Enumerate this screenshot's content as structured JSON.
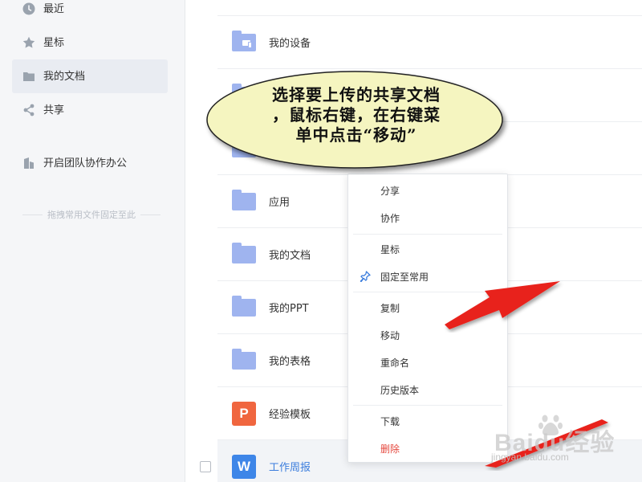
{
  "sidebar": {
    "items": [
      {
        "label": "最近",
        "icon": "clock-icon"
      },
      {
        "label": "星标",
        "icon": "star-icon"
      },
      {
        "label": "我的文档",
        "icon": "folder-icon",
        "active": true
      },
      {
        "label": "共享",
        "icon": "share-icon"
      },
      {
        "label": "开启团队协作办公",
        "icon": "team-icon"
      }
    ],
    "pin_hint": "拖拽常用文件固定至此"
  },
  "files": [
    {
      "name": "我的设备",
      "type": "device-folder"
    },
    {
      "name": "",
      "type": "folder"
    },
    {
      "name": "",
      "type": "folder"
    },
    {
      "name": "应用",
      "type": "folder"
    },
    {
      "name": "我的文档",
      "type": "folder"
    },
    {
      "name": "我的PPT",
      "type": "folder"
    },
    {
      "name": "我的表格",
      "type": "folder"
    },
    {
      "name": "经验模板",
      "type": "presentation",
      "icon_letter": "P"
    },
    {
      "name": "工作周报",
      "type": "document",
      "icon_letter": "W",
      "selected": true
    }
  ],
  "context_menu": {
    "items": [
      "分享",
      "协作",
      "星标",
      "固定至常用",
      "复制",
      "移动",
      "重命名",
      "历史版本",
      "下载",
      "删除"
    ]
  },
  "annotation": {
    "line1": "选择要上传的共享文档",
    "line2": "，鼠标右键，在右键菜",
    "line3": "单中点击“移动”"
  },
  "watermark": {
    "brand": "Baidu经验",
    "url": "jingyan.baidu.com"
  },
  "colors": {
    "accent": "#3b7ddd",
    "folder": "#9fb4ef",
    "danger": "#e5483e",
    "bubble_fill": "#f5f5c0",
    "arrow": "#e8231b"
  }
}
